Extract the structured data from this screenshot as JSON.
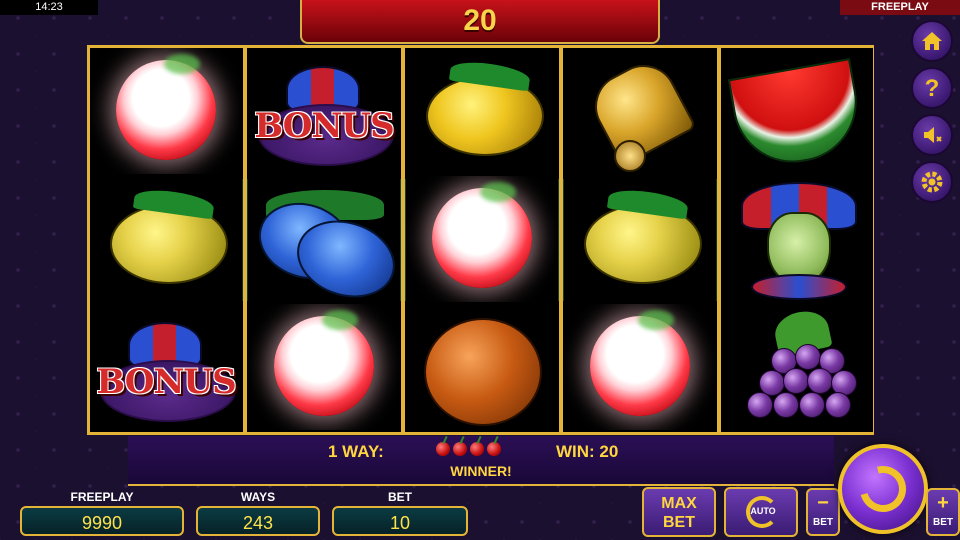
{
  "status": {
    "time": "14:23",
    "mode": "FREEPLAY"
  },
  "top_win": "20",
  "reels": [
    [
      "cherry-glow",
      "lemon",
      "bonus"
    ],
    [
      "bonus",
      "plum",
      "cherry-glow"
    ],
    [
      "lemon",
      "cherry-glow",
      "orange"
    ],
    [
      "bell",
      "lemon",
      "cherry-glow"
    ],
    [
      "watermelon",
      "joker",
      "grapes"
    ]
  ],
  "bonus_symbol_text": "BONUS",
  "win_info": {
    "ways_label": "1 WAY:",
    "win_label": "WIN: 20",
    "winner_label": "WINNER!",
    "cherry_count": 4
  },
  "stats": {
    "freeplay_label": "FREEPLAY",
    "freeplay_value": "9990",
    "ways_label": "WAYS",
    "ways_value": "243",
    "bet_label": "BET",
    "bet_value": "10"
  },
  "side_menu": {
    "home_icon": "home-icon",
    "help_label": "?",
    "sound_icon": "sound-muted-icon",
    "settings_icon": "gear-icon"
  },
  "controls": {
    "maxbet_line1": "MAX",
    "maxbet_line2": "BET",
    "auto_label": "AUTO",
    "minus_symbol": "−",
    "minus_label": "BET",
    "plus_symbol": "+",
    "plus_label": "BET"
  },
  "colors": {
    "accent_gold": "#e3b437",
    "value_yellow": "#ffe24a",
    "panel_purple": "#3a1c73"
  }
}
